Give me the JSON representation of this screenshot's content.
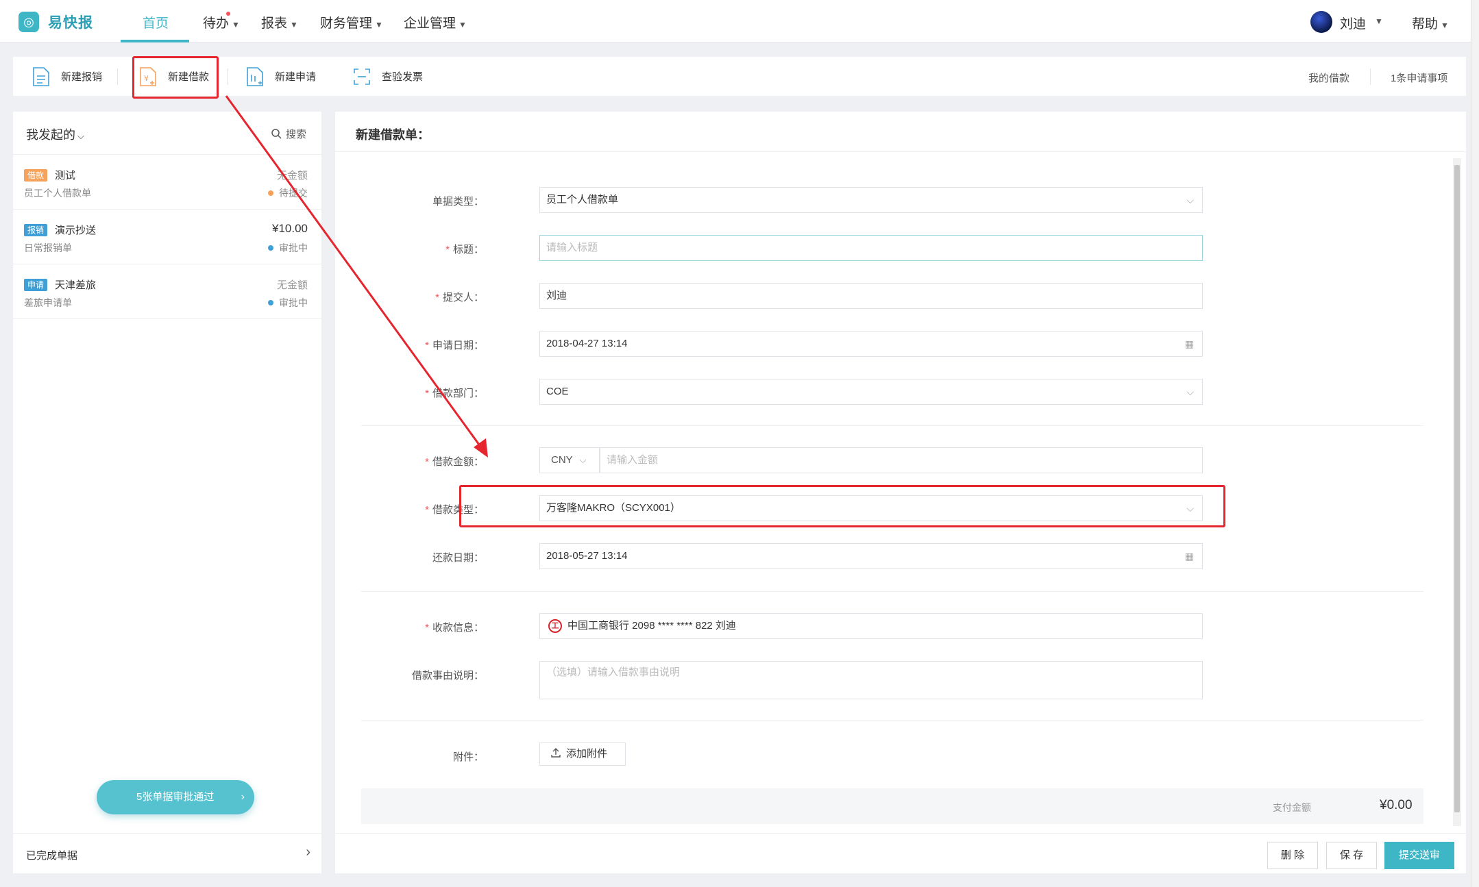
{
  "app": {
    "brand": "易快报"
  },
  "nav": {
    "items": [
      {
        "label": "首页"
      },
      {
        "label": "待办"
      },
      {
        "label": "报表"
      },
      {
        "label": "财务管理"
      },
      {
        "label": "企业管理"
      }
    ],
    "user": "刘迪",
    "help": "帮助",
    "active": "首页"
  },
  "toolbar": {
    "new_expense": "新建报销",
    "new_loan": "新建借款",
    "new_request": "新建申请",
    "check_invoice": "查验发票",
    "my_loans": "我的借款",
    "pending": "1条申请事项"
  },
  "sidebar": {
    "filter": "我发起的",
    "search": "搜索",
    "items": [
      {
        "tag": "借款",
        "tag_color": "#f6a25b",
        "title": "测试",
        "subtitle": "员工个人借款单",
        "amount": "无金额",
        "status": "待提交",
        "status_color": "#f6a25b"
      },
      {
        "tag": "报销",
        "tag_color": "#3fa0d8",
        "title": "演示抄送",
        "subtitle": "日常报销单",
        "amount": "¥10.00",
        "status": "审批中",
        "status_color": "#3fa0d8"
      },
      {
        "tag": "申请",
        "tag_color": "#3fa0d8",
        "title": "天津差旅",
        "subtitle": "差旅申请单",
        "amount": "无金额",
        "status": "审批中",
        "status_color": "#3fa0d8"
      }
    ],
    "batch_button": "5张单据审批通过",
    "completed": "已完成单据"
  },
  "form": {
    "title": "新建借款单：",
    "doc_type": {
      "label": "单据类型：",
      "value": "员工个人借款单"
    },
    "doc_title": {
      "label": "标题：",
      "placeholder": "请输入标题"
    },
    "submitter": {
      "label": "提交人：",
      "value": "刘迪"
    },
    "apply_date": {
      "label": "申请日期：",
      "value": "2018-04-27 13:14"
    },
    "department": {
      "label": "借款部门：",
      "value": "COE"
    },
    "amount": {
      "label": "借款金额：",
      "currency": "CNY",
      "placeholder": "请输入金额"
    },
    "loan_type": {
      "label": "借款类型：",
      "value": "万客隆MAKRO（SCYX001）"
    },
    "repay_date": {
      "label": "还款日期：",
      "value": "2018-05-27 13:14"
    },
    "payee": {
      "label": "收款信息：",
      "value": "中国工商银行 2098 **** **** 822 刘迪"
    },
    "reason": {
      "label": "借款事由说明：",
      "placeholder": "（选填）请输入借款事由说明"
    },
    "attachment": {
      "label": "附件：",
      "button": "添加附件"
    },
    "pay_amount": {
      "label": "支付金额",
      "value": "¥0.00"
    },
    "buttons": {
      "delete": "删 除",
      "save": "保 存",
      "submit": "提交送审"
    }
  },
  "colors": {
    "accent": "#3fb6c6",
    "annotation": "#e5262e",
    "required": "#f2555a"
  }
}
